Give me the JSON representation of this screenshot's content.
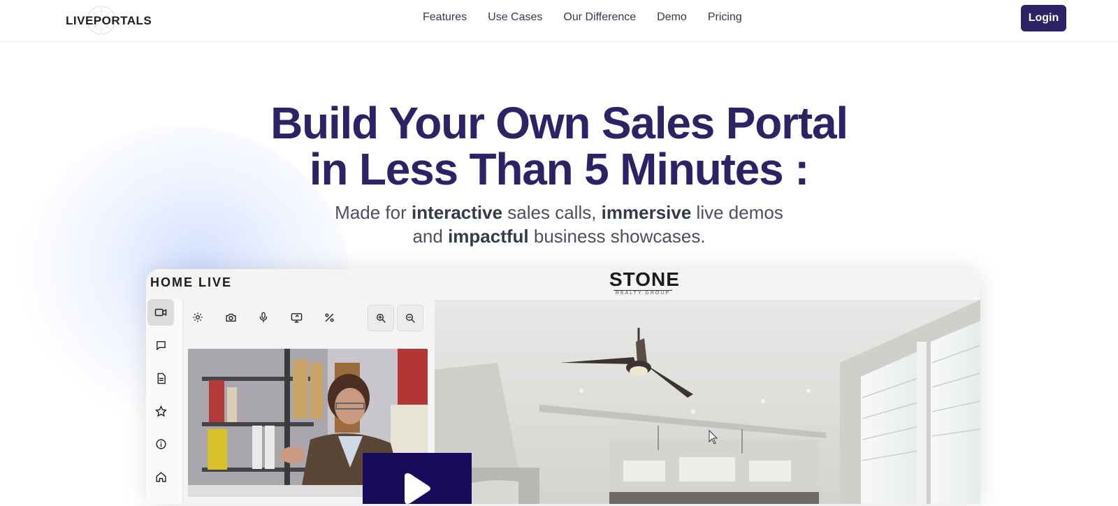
{
  "brand": {
    "logo_text": "LIVEPORTALS"
  },
  "nav": {
    "items": [
      {
        "label": "Features"
      },
      {
        "label": "Use Cases"
      },
      {
        "label": "Our Difference"
      },
      {
        "label": "Demo"
      },
      {
        "label": "Pricing"
      }
    ],
    "login_label": "Login"
  },
  "hero": {
    "title_line1": "Build Your Own Sales Portal",
    "title_line2": "in Less Than 5 Minutes :",
    "sub": {
      "p1": "Made for ",
      "b1": "interactive",
      "p2": " sales calls, ",
      "b2": "immersive",
      "p3": " live demos",
      "p4": "and ",
      "b3": "impactful",
      "p5": " business showcases."
    }
  },
  "demo": {
    "app_title": "HOME LIVE",
    "brand_name": "STONE",
    "brand_sub": "REALTY GROUP",
    "sidebar_icons": [
      "video-camera-icon",
      "chat-bubble-icon",
      "document-icon",
      "star-icon",
      "info-icon",
      "home-icon"
    ],
    "toolbar_icons": [
      "gear-icon",
      "camera-icon",
      "microphone-icon",
      "screen-share-icon",
      "percent-icon",
      "zoom-in-icon",
      "zoom-out-icon"
    ],
    "play_icon": "play-icon"
  },
  "colors": {
    "primary": "#2c2366",
    "play_button": "#1a0a5c",
    "subtitle": "#4a5060"
  }
}
